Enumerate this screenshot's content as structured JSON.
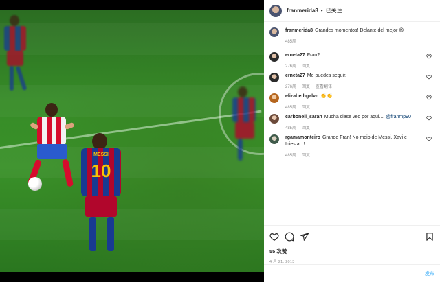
{
  "header": {
    "username": "franmerida8",
    "separator": "•",
    "follow_status": "已关注"
  },
  "caption": {
    "username": "franmerida8",
    "text": "Grandes momentos! Delante del mejor 😉",
    "time": "485周"
  },
  "comments": [
    {
      "username": "erneta27",
      "text": "Fran?",
      "time": "276周",
      "reply": "回复",
      "extra": ""
    },
    {
      "username": "erneta27",
      "text": "Me puedes seguir.",
      "time": "276周",
      "reply": "回复",
      "extra": "查看翻译"
    },
    {
      "username": "elizabethgalvn",
      "text": "👏👏",
      "time": "485周",
      "reply": "回复",
      "extra": ""
    },
    {
      "username": "carbonell_saran",
      "text": "Mucha clase veo por aqui.... ",
      "mention": "@franmp90",
      "time": "485周",
      "reply": "回复",
      "extra": ""
    },
    {
      "username": "rgamamonteiro",
      "text": "Grande Fran! No meio de Messi, Xavi e Iniesta...!",
      "time": "485周",
      "reply": "回复",
      "extra": ""
    }
  ],
  "actions": {
    "likes": "55 次赞",
    "date": "4 月 21, 2013"
  },
  "add_comment": {
    "post_label": "发布"
  },
  "photo": {
    "jersey_number": "10",
    "jersey_name": "MESSI"
  },
  "colors": {
    "link_blue": "#0095f6",
    "mention_blue": "#00376b",
    "meta_gray": "#8e8e8e"
  }
}
